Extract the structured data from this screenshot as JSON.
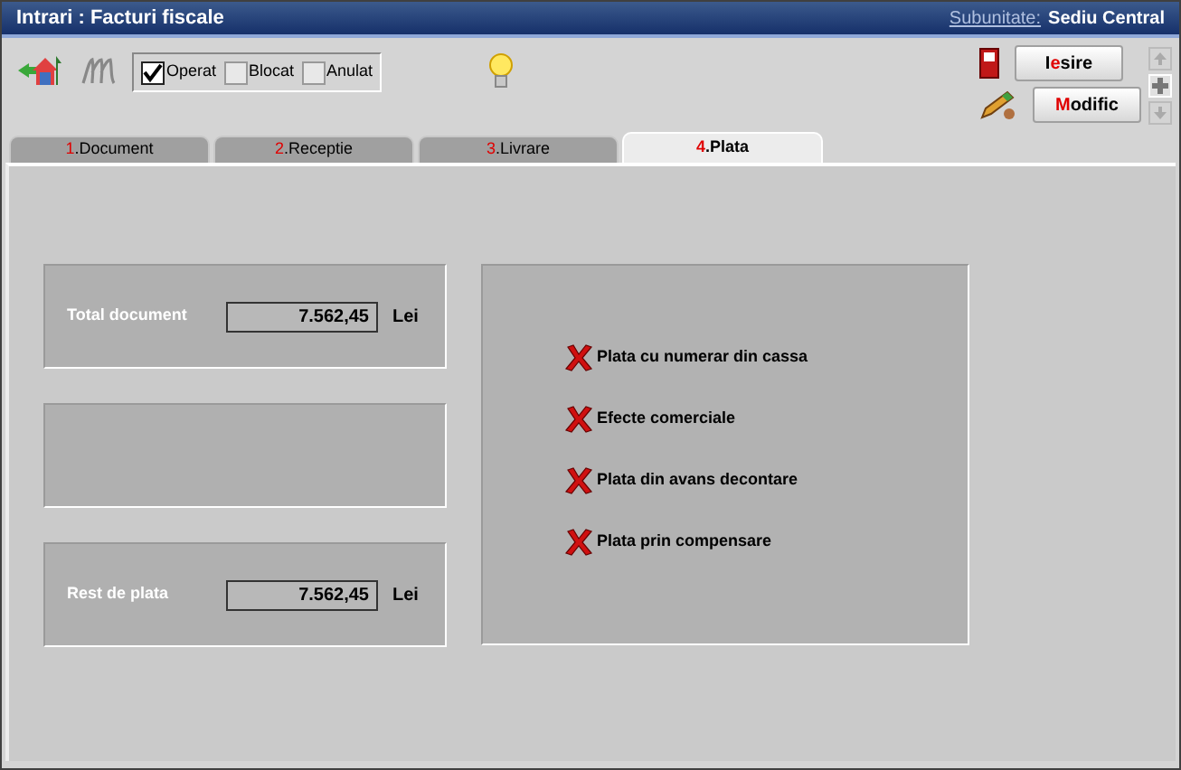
{
  "window": {
    "title": "Intrari : Facturi fiscale",
    "subunit_label": "Subunitate:",
    "subunit_value": "Sediu Central"
  },
  "toolbar": {
    "flags": [
      {
        "label": "Operat",
        "checked": true
      },
      {
        "label": "Blocat",
        "checked": false
      },
      {
        "label": "Anulat",
        "checked": false
      }
    ],
    "buttons": [
      {
        "parts": [
          {
            "text": "I",
            "hot": false
          },
          {
            "text": "e",
            "hot": true
          },
          {
            "text": "sire",
            "hot": false
          }
        ]
      },
      {
        "parts": [
          {
            "text": "M",
            "hot": true
          },
          {
            "text": "odific",
            "hot": false
          }
        ]
      }
    ]
  },
  "tabs": [
    {
      "number": "1",
      "label": ".Document",
      "selected": false
    },
    {
      "number": "2",
      "label": ".Receptie",
      "selected": false
    },
    {
      "number": "3",
      "label": ".Livrare",
      "selected": false
    },
    {
      "number": "4",
      "label": ".Plata",
      "selected": true
    }
  ],
  "totals": [
    {
      "label": "Total document",
      "value": "7.562,45",
      "unit": "Lei"
    },
    {
      "label": "Rest de plata",
      "value": "7.562,45",
      "unit": "Lei"
    }
  ],
  "payment_options": [
    {
      "label": "Plata cu numerar din cassa",
      "enabled": false
    },
    {
      "label": "Efecte comerciale",
      "enabled": false
    },
    {
      "label": "Plata din avans decontare",
      "enabled": false
    },
    {
      "label": "Plata prin compensare",
      "enabled": false
    }
  ]
}
